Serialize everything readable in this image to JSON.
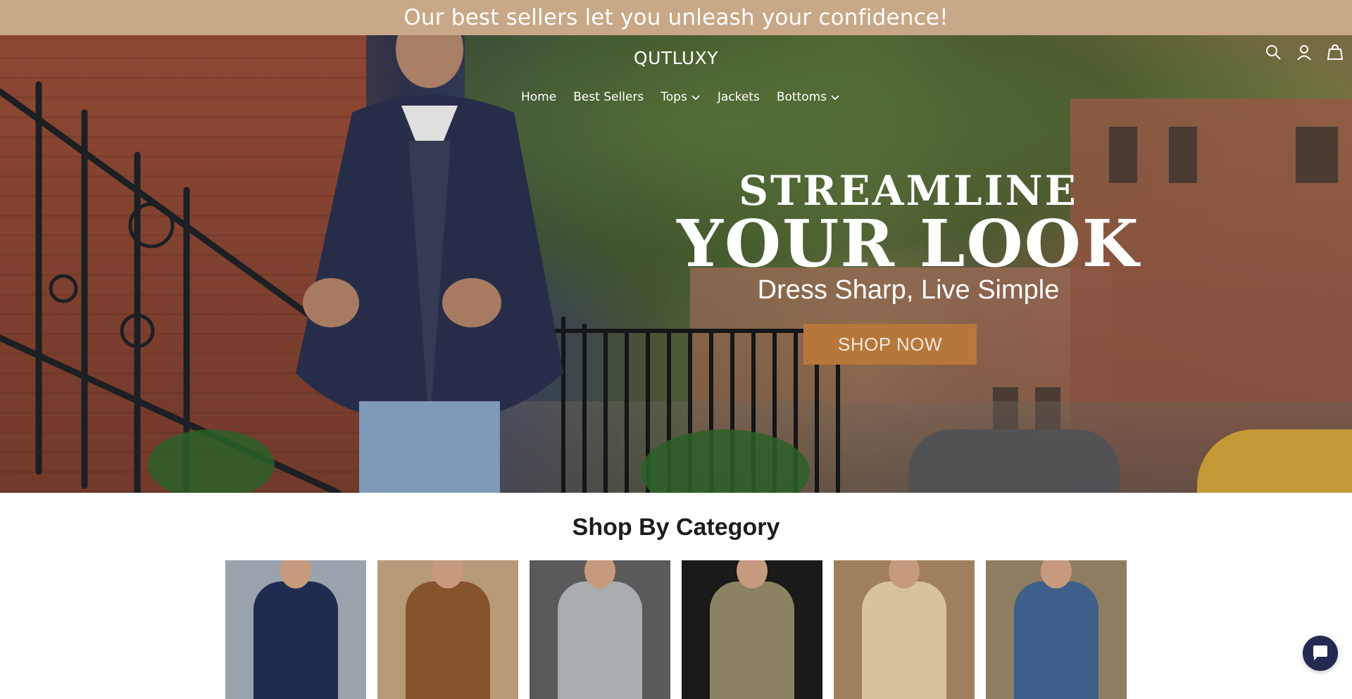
{
  "announcement": {
    "text": "Our best sellers let you unleash your confidence!"
  },
  "header": {
    "logo": "QUTLUXY",
    "nav": [
      {
        "label": "Home",
        "has_dropdown": false
      },
      {
        "label": "Best Sellers",
        "has_dropdown": false
      },
      {
        "label": "Tops",
        "has_dropdown": true
      },
      {
        "label": "Jackets",
        "has_dropdown": false
      },
      {
        "label": "Bottoms",
        "has_dropdown": true
      }
    ],
    "icons": [
      "search-icon",
      "account-icon",
      "cart-icon"
    ]
  },
  "hero": {
    "line1": "STREAMLINE",
    "line2": "YOUR LOOK",
    "line3": "Dress Sharp, Live Simple",
    "cta_label": "SHOP NOW"
  },
  "categories": {
    "title": "Shop By Category",
    "items": [
      {
        "name": "polo-shirt",
        "bg": "#9aa2ab",
        "color": "#1f2c50"
      },
      {
        "name": "shirt-jacket",
        "bg": "#b79a78",
        "color": "#86542c"
      },
      {
        "name": "sweater",
        "bg": "#5a5a5a",
        "color": "#a9acb0"
      },
      {
        "name": "plaid-jacket",
        "bg": "#1a1a1a",
        "color": "#8c8163"
      },
      {
        "name": "shorts",
        "bg": "#a0805c",
        "color": "#d9c29e"
      },
      {
        "name": "jeans",
        "bg": "#8e7d63",
        "color": "#3e5f8a"
      }
    ]
  },
  "colors": {
    "announcement_bg": "#c8a887",
    "cta_bg": "#b8773a",
    "chat_bg": "#232a52"
  }
}
